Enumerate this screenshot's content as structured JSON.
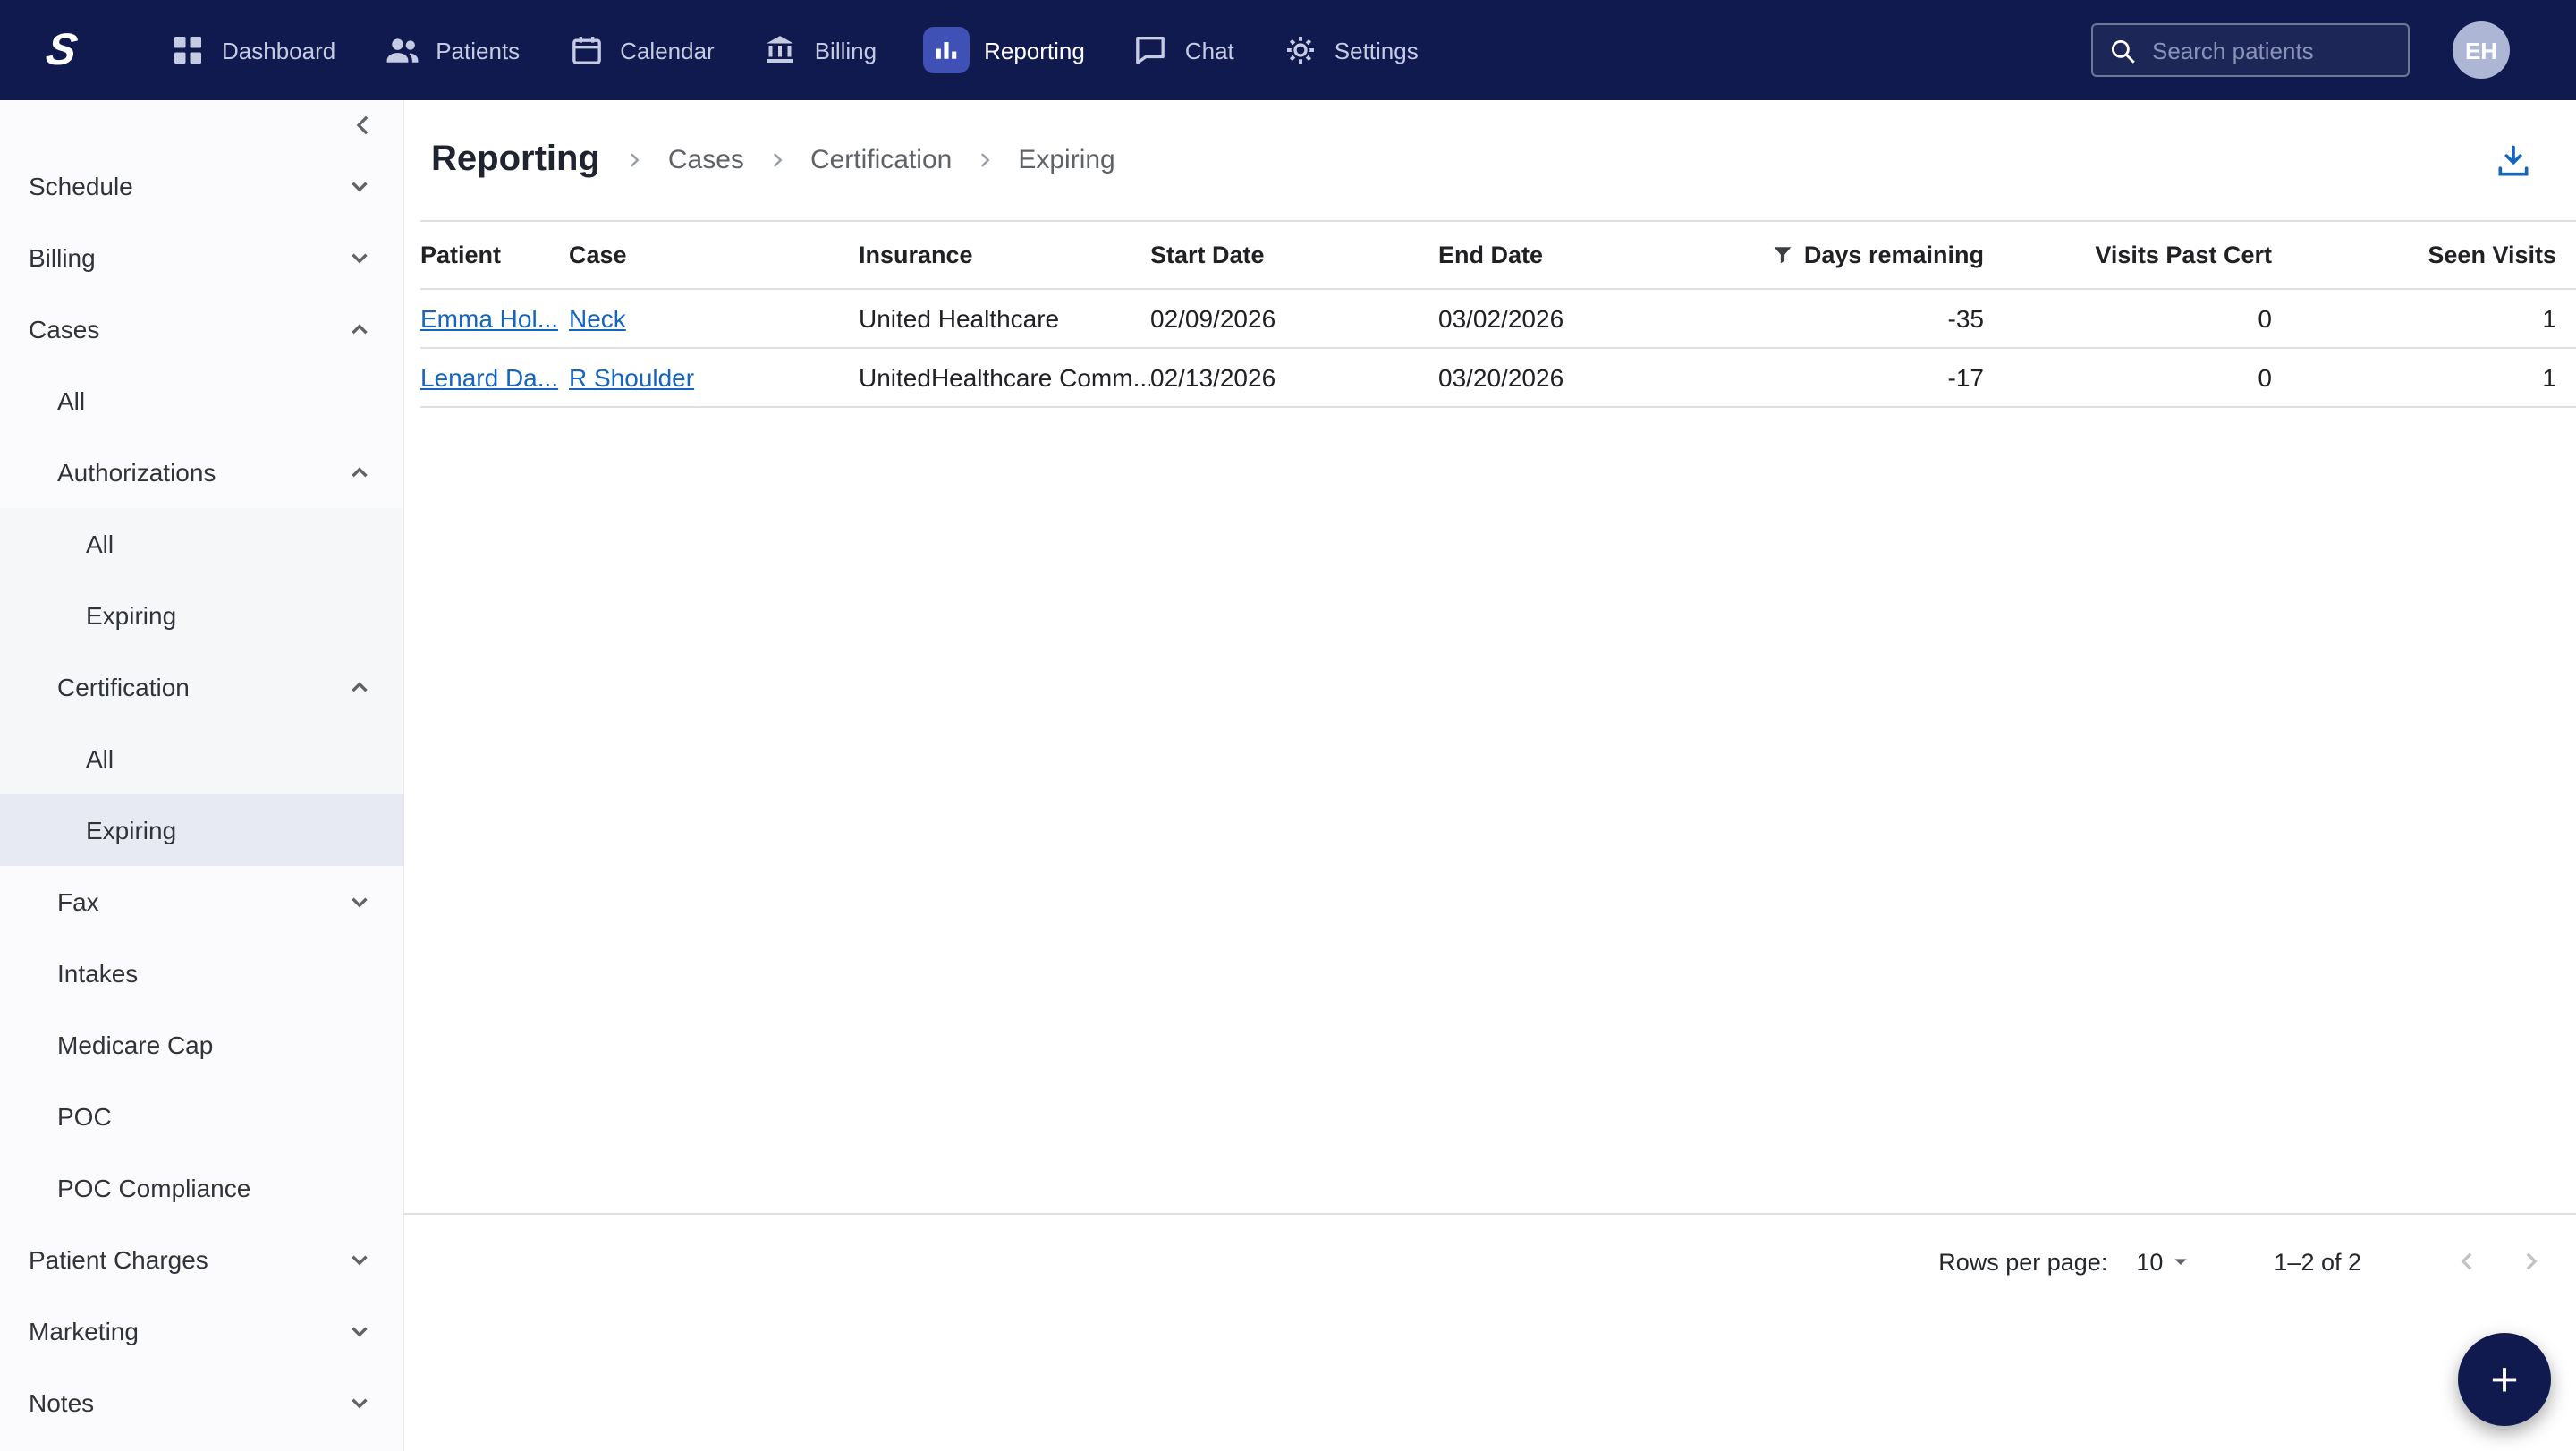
{
  "navbar": {
    "logo_letter": "S",
    "items": [
      {
        "label": "Dashboard"
      },
      {
        "label": "Patients"
      },
      {
        "label": "Calendar"
      },
      {
        "label": "Billing"
      },
      {
        "label": "Reporting"
      },
      {
        "label": "Chat"
      },
      {
        "label": "Settings"
      }
    ],
    "search_placeholder": "Search patients",
    "avatar_initials": "EH"
  },
  "sidebar": {
    "items": [
      {
        "label": "Schedule"
      },
      {
        "label": "Billing"
      },
      {
        "label": "Cases"
      },
      {
        "label": "All"
      },
      {
        "label": "Authorizations"
      },
      {
        "label": "All"
      },
      {
        "label": "Expiring"
      },
      {
        "label": "Certification"
      },
      {
        "label": "All"
      },
      {
        "label": "Expiring"
      },
      {
        "label": "Fax"
      },
      {
        "label": "Intakes"
      },
      {
        "label": "Medicare Cap"
      },
      {
        "label": "POC"
      },
      {
        "label": "POC Compliance"
      },
      {
        "label": "Patient Charges"
      },
      {
        "label": "Marketing"
      },
      {
        "label": "Notes"
      }
    ]
  },
  "breadcrumb": {
    "items": [
      "Reporting",
      "Cases",
      "Certification",
      "Expiring"
    ]
  },
  "table": {
    "columns": [
      "Patient",
      "Case",
      "Insurance",
      "Start Date",
      "End Date",
      "Days remaining",
      "Visits Past Cert",
      "Seen Visits"
    ],
    "rows": [
      {
        "patient": "Emma Hol...",
        "case": "Neck",
        "insurance": "United Healthcare",
        "start_date": "02/09/2026",
        "end_date": "03/02/2026",
        "days_remaining": "-35",
        "visits_past_cert": "0",
        "seen_visits": "1"
      },
      {
        "patient": "Lenard Da...",
        "case": "R Shoulder",
        "insurance": "UnitedHealthcare Comm...",
        "start_date": "02/13/2026",
        "end_date": "03/20/2026",
        "days_remaining": "-17",
        "visits_past_cert": "0",
        "seen_visits": "1"
      }
    ]
  },
  "pagination": {
    "rows_per_page_label": "Rows per page:",
    "rows_per_page_value": "10",
    "range_label": "1–2 of 2"
  },
  "fab": {
    "label": "+"
  },
  "colors": {
    "navy": "#101a4e",
    "accent_blue": "#3f51b5",
    "link_blue": "#1565c0"
  }
}
